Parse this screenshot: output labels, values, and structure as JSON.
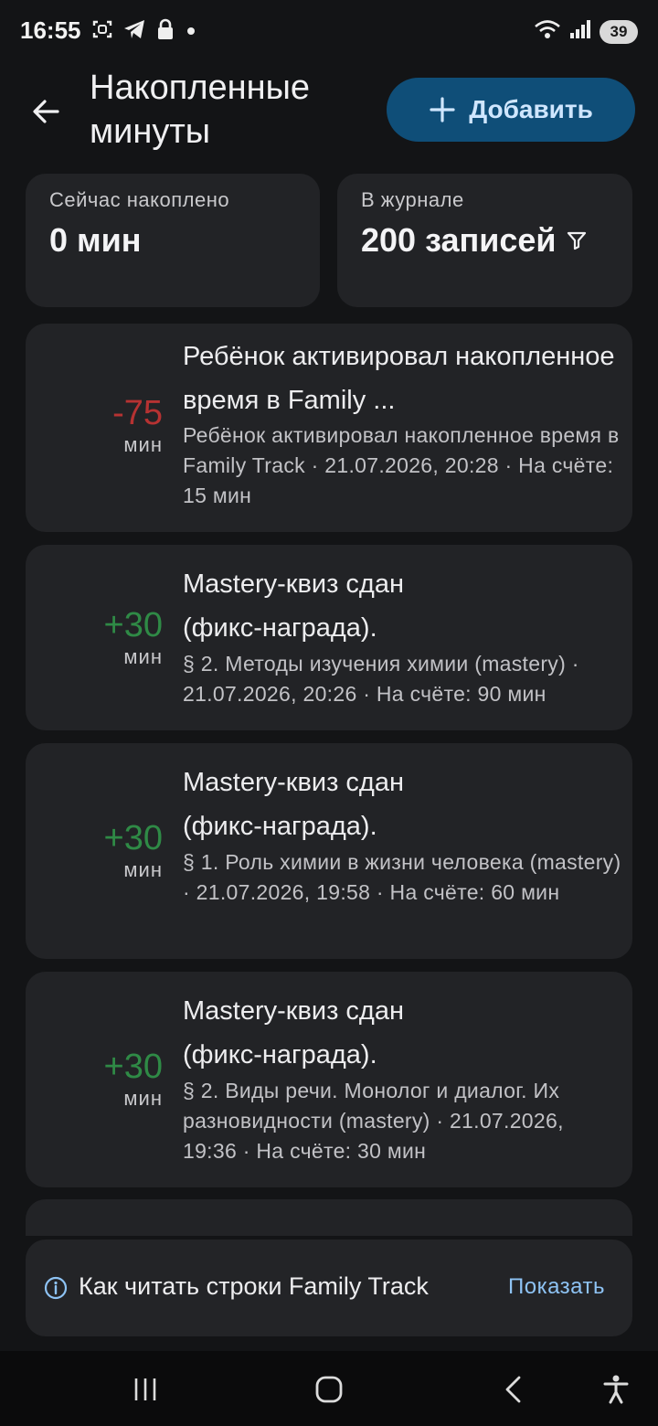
{
  "status_bar": {
    "time": "16:55",
    "icons_left": [
      "screenshot-icon",
      "telegram-icon",
      "lock-icon",
      "dot-icon"
    ],
    "icons_right": [
      "wifi-icon",
      "signal-icon"
    ],
    "battery": "39"
  },
  "header": {
    "title": "Накопленные минуты",
    "add_button_label": "Добавить"
  },
  "summary": {
    "accumulated_label": "Сейчас накоплено",
    "accumulated_value": "0 мин",
    "journal_label": "В журнале",
    "journal_value": "200 записей"
  },
  "entries": [
    {
      "delta": "-75",
      "unit": "мин",
      "title": "Ребёнок активировал накопленное время в Family ...",
      "description": "Ребёнок активировал накопленное время в Family Track · 21.07.2026, 20:28 · На счёте: 15 мин"
    },
    {
      "delta": "+30",
      "unit": "мин",
      "title": "Mastery-квиз сдан (фикс-награда).",
      "description": "§ 2. Методы изучения химии (mastery) · 21.07.2026, 20:26 · На счёте: 90 мин"
    },
    {
      "delta": "+30",
      "unit": "мин",
      "title": "Mastery-квиз сдан (фикс-награда).",
      "description": "§ 1. Роль химии в жизни человека (mastery) · 21.07.2026, 19:58 · На счёте: 60 мин"
    },
    {
      "delta": "+30",
      "unit": "мин",
      "title": "Mastery-квиз сдан (фикс-награда).",
      "description": "§ 2. Виды речи. Монолог и диалог. Их разновидности (mastery) · 21.07.2026, 19:36 · На счёте: 30 мин"
    }
  ],
  "info_banner": {
    "text": "Как читать строки Family Track",
    "action": "Показать"
  },
  "colors": {
    "negative": "#b63232",
    "positive": "#2f8a46",
    "accent_button": "#0f4e78",
    "link": "#8ec3f4"
  }
}
